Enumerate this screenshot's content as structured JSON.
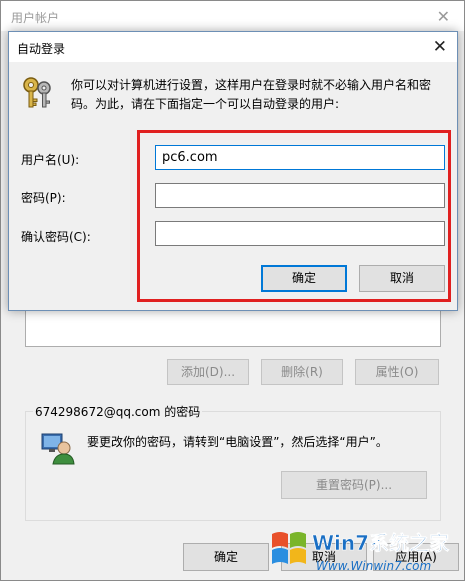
{
  "background_window": {
    "title": "用户帐户",
    "buttons": {
      "add": "添加(D)...",
      "delete": "删除(R)",
      "properties": "属性(O)"
    },
    "password_group": {
      "legend": "674298672@qq.com 的密码",
      "info": "要更改你的密码，请转到“电脑设置”，然后选择“用户”。",
      "reset_button": "重置密码(P)..."
    },
    "bottom_buttons": {
      "ok": "确定",
      "cancel": "取消",
      "apply": "应用(A)"
    }
  },
  "dialog": {
    "title": "自动登录",
    "description": "你可以对计算机进行设置，这样用户在登录时就不必输入用户名和密码。为此，请在下面指定一个可以自动登录的用户:",
    "fields": {
      "username": {
        "label": "用户名(U):",
        "value": "pc6.com"
      },
      "password": {
        "label": "密码(P):",
        "value": ""
      },
      "confirm": {
        "label": "确认密码(C):",
        "value": ""
      }
    },
    "ok_button": "确定",
    "cancel_button": "取消"
  },
  "watermark": {
    "brand": "Win7系统之家",
    "url": "Www.Winwin7.com"
  },
  "colors": {
    "highlight": "#e02020",
    "focus": "#0078d7"
  }
}
